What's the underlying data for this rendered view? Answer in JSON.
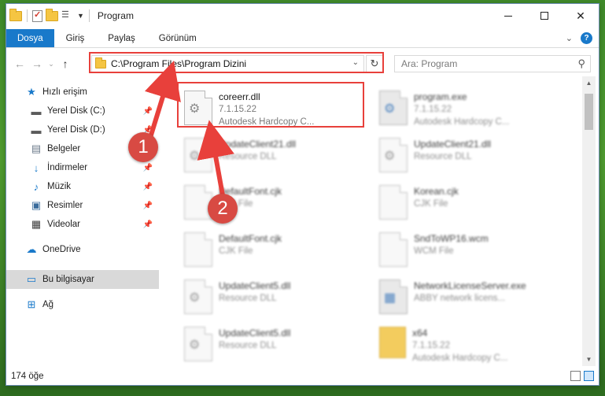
{
  "window": {
    "title": "Program",
    "controls": {
      "minimize": "—",
      "maximize": "☐",
      "close": "✕"
    }
  },
  "ribbon": {
    "tabs": [
      {
        "label": "Dosya",
        "active": true
      },
      {
        "label": "Giriş"
      },
      {
        "label": "Paylaş"
      },
      {
        "label": "Görünüm"
      }
    ],
    "help": "?"
  },
  "address": {
    "path": "C:\\Program Files\\Program Dizini",
    "search_placeholder": "Ara: Program"
  },
  "sidebar": {
    "items": [
      {
        "label": "Hızlı erişim",
        "icon": "star-icon"
      },
      {
        "label": "Yerel Disk (C:)",
        "icon": "drive-icon"
      },
      {
        "label": "Yerel Disk (D:)",
        "icon": "drive-icon"
      },
      {
        "label": "Belgeler",
        "icon": "document-icon"
      },
      {
        "label": "İndirmeler",
        "icon": "download-icon"
      },
      {
        "label": "Müzik",
        "icon": "music-icon"
      },
      {
        "label": "Resimler",
        "icon": "pictures-icon"
      },
      {
        "label": "Videolar",
        "icon": "video-icon"
      },
      {
        "label": "OneDrive",
        "icon": "cloud-icon"
      },
      {
        "label": "Bu bilgisayar",
        "icon": "computer-icon",
        "selected": true
      },
      {
        "label": "Ağ",
        "icon": "network-icon"
      }
    ]
  },
  "files": [
    {
      "name": "coreerr.dll",
      "line2": "7.1.15.22",
      "line3": "Autodesk Hardcopy C..."
    },
    {
      "name": "program.exe",
      "line2": "7.1.15.22",
      "line3": "Autodesk Hardcopy C..."
    },
    {
      "name": "UpdateClient21.dll",
      "line2": "Resource DLL"
    },
    {
      "name": "UpdateClient21.dll",
      "line2": "Resource DLL"
    },
    {
      "name": "DefaultFont.cjk",
      "line2": "CJK File"
    },
    {
      "name": "Korean.cjk",
      "line2": "CJK File"
    },
    {
      "name": "DefaultFont.cjk",
      "line2": "CJK File"
    },
    {
      "name": "SndToWP16.wcm",
      "line2": "WCM File"
    },
    {
      "name": "UpdateClient5.dll",
      "line2": "Resource DLL"
    },
    {
      "name": "NetworkLicenseServer.exe",
      "line2": "ABBY network licens..."
    },
    {
      "name": "UpdateClient5.dll",
      "line2": "Resource DLL"
    },
    {
      "name": "x64",
      "line2": "7.1.15.22",
      "line3": "Autodesk Hardcopy C..."
    }
  ],
  "status": {
    "count": "174 öğe"
  },
  "annotations": {
    "badge1": "1",
    "badge2": "2"
  },
  "colors": {
    "accent": "#1979ca",
    "highlight": "#e8403b",
    "badge": "#d84a43"
  }
}
